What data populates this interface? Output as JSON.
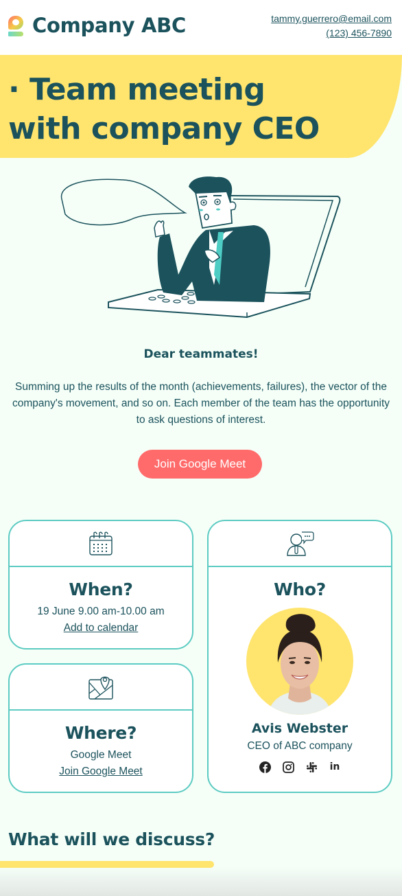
{
  "header": {
    "brand": "Company ABC",
    "email": "tammy.guerrero@email.com",
    "phone": "(123) 456-7890"
  },
  "hero": {
    "title": "· Team meeting with company CEO"
  },
  "intro": {
    "greeting": "Dear teammates!",
    "body": "Summing up the results of the month (achievements, failures), the vector of the company's movement, and so on. Each member of the team has the opportunity to ask questions of interest.",
    "cta_label": "Join Google Meet"
  },
  "cards": {
    "when": {
      "icon": "calendar-icon",
      "title": "When?",
      "detail": "19 June 9.00 am-10.00 am",
      "link": "Add to calendar"
    },
    "where": {
      "icon": "map-pin-icon",
      "title": "Where?",
      "detail": "Google Meet",
      "link": "Join Google Meet"
    },
    "who": {
      "icon": "speaker-icon",
      "title": "Who?",
      "name": "Avis Webster",
      "role": "CEO of ABC company",
      "socials": [
        "facebook-icon",
        "instagram-icon",
        "slack-icon",
        "linkedin-icon"
      ],
      "linkedin_text": "in"
    }
  },
  "discuss": {
    "title": "What will we discuss?"
  },
  "colors": {
    "primary": "#1b525c",
    "accent_yellow": "#ffe46d",
    "accent_coral": "#ff6b6b",
    "border_teal": "#5ccbc2",
    "background": "#f5fff8"
  }
}
